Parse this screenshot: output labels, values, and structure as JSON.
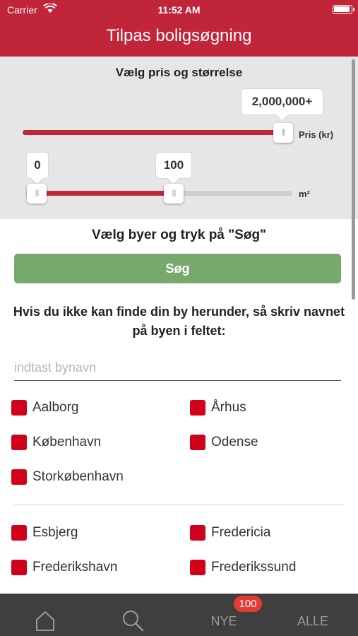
{
  "status_bar": {
    "carrier": "Carrier",
    "time": "11:52 AM"
  },
  "nav": {
    "title": "Tilpas boligsøgning"
  },
  "filters": {
    "title": "Vælg pris og størrelse",
    "price": {
      "tooltip": "2,000,000+",
      "unit": "Pris (kr)",
      "fill_fraction": 1.0
    },
    "size": {
      "min_tooltip": "0",
      "max_tooltip": "100",
      "unit": "m²",
      "min_fraction": 0.0,
      "max_fraction": 0.55
    }
  },
  "cities_section": {
    "title": "Vælg byer og tryk på \"Søg\"",
    "search_button": "Søg",
    "hint": "Hvis du ikke kan finde din by herunder, så skriv navnet på byen i feltet:",
    "input_placeholder": "indtast bynavn",
    "group1": [
      "Aalborg",
      "Århus",
      "København",
      "Odense",
      "Storkøbenhavn"
    ],
    "group2": [
      "Esbjerg",
      "Fredericia",
      "Frederikshavn",
      "Frederikssund"
    ]
  },
  "tabbar": {
    "new_label": "NYE",
    "new_badge": "100",
    "all_label": "ALLE"
  },
  "colors": {
    "brand_red": "#c0253a",
    "checkbox_red": "#d0021b",
    "search_green": "#76a96b",
    "tabbar_bg": "#3f3f3f"
  },
  "icons": [
    "wifi-icon",
    "battery-icon",
    "home-icon",
    "search-icon"
  ]
}
